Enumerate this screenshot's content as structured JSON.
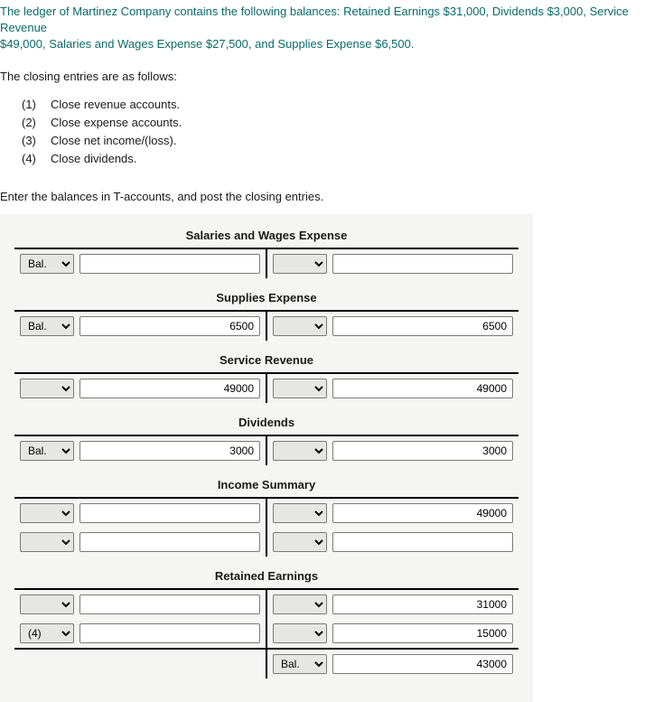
{
  "intro": {
    "line1a": "The ledger of Martinez Company contains the following balances: Retained Earnings $31,000, Dividends $3,000, Service Revenue",
    "line1b": "$49,000, Salaries and Wages Expense $27,500, and Supplies Expense $6,500.",
    "closing": "The closing entries are as follows:"
  },
  "steps": [
    {
      "num": "(1)",
      "text": "Close revenue accounts."
    },
    {
      "num": "(2)",
      "text": "Close expense accounts."
    },
    {
      "num": "(3)",
      "text": "Close net income/(loss)."
    },
    {
      "num": "(4)",
      "text": "Close dividends."
    }
  ],
  "instruction": "Enter the balances in T-accounts, and post the closing entries.",
  "labels": {
    "bal": "Bal."
  },
  "accounts": {
    "salaries": {
      "title": "Salaries and Wages Expense",
      "rows": [
        {
          "left_sel": "Bal.",
          "left_val": "",
          "right_sel": "",
          "right_val": ""
        }
      ]
    },
    "supplies": {
      "title": "Supplies Expense",
      "rows": [
        {
          "left_sel": "Bal.",
          "left_val": "6500",
          "right_sel": "",
          "right_val": "6500"
        }
      ]
    },
    "service": {
      "title": "Service Revenue",
      "rows": [
        {
          "left_sel": "",
          "left_val": "49000",
          "right_sel": "",
          "right_val": "49000"
        }
      ]
    },
    "dividends": {
      "title": "Dividends",
      "rows": [
        {
          "left_sel": "Bal.",
          "left_val": "3000",
          "right_sel": "",
          "right_val": "3000"
        }
      ]
    },
    "income": {
      "title": "Income Summary",
      "rows": [
        {
          "left_sel": "",
          "left_val": "",
          "right_sel": "",
          "right_val": "49000"
        },
        {
          "left_sel": "",
          "left_val": "",
          "right_sel": "",
          "right_val": ""
        }
      ]
    },
    "retained": {
      "title": "Retained Earnings",
      "rows": [
        {
          "left_sel": "",
          "left_val": "",
          "right_sel": "",
          "right_val": "31000"
        },
        {
          "left_sel": "(4)",
          "left_val": "",
          "right_sel": "",
          "right_val": "15000"
        }
      ],
      "footer": {
        "right_sel": "Bal.",
        "right_val": "43000"
      }
    }
  }
}
